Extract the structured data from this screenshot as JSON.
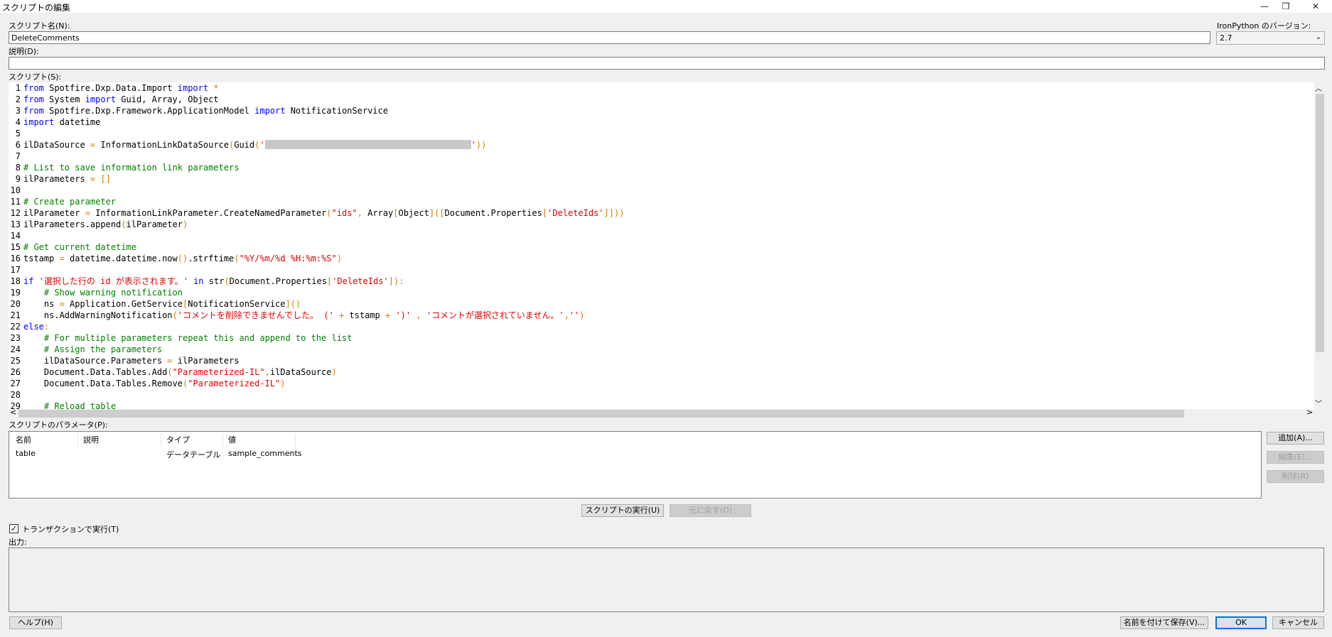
{
  "window": {
    "title": "スクリプトの編集",
    "minimize": "—",
    "restore": "❐",
    "close": "✕"
  },
  "script_name": {
    "label": "スクリプト名(N):",
    "value": "DeleteComments"
  },
  "ironpython": {
    "label": "IronPython のバージョン:",
    "value": "2.7"
  },
  "description": {
    "label": "説明(D):",
    "value": ""
  },
  "script": {
    "label": "スクリプト(S):",
    "scroll_up": "︿",
    "scroll_down": "﹀",
    "scroll_left": "<",
    "scroll_right": ">"
  },
  "params": {
    "label": "スクリプトのパラメータ(P):",
    "columns": [
      "名前",
      "説明",
      "タイプ",
      "値"
    ],
    "rows": [
      {
        "name": "table",
        "description": "",
        "type": "データテーブル",
        "value": "sample_comments"
      }
    ],
    "add_button": "追加(A)...",
    "edit_button": "編集(E)...",
    "delete_button": "削除(R)"
  },
  "actions": {
    "run_button": "スクリプトの実行(U)",
    "undo_button": "元に戻す(O)"
  },
  "transaction": {
    "checked": true,
    "checkmark": "✓",
    "label": "トランザクションで実行(T)"
  },
  "output": {
    "label": "出力:",
    "value": ""
  },
  "footer": {
    "help_button": "ヘルプ(H)",
    "save_as_button": "名前を付けて保存(V)...",
    "ok_button": "OK",
    "cancel_button": "キャンセル"
  },
  "colors": {
    "keyword": "#0000ff",
    "comment": "#008000",
    "string": "#e00000",
    "operator": "#d08000"
  }
}
